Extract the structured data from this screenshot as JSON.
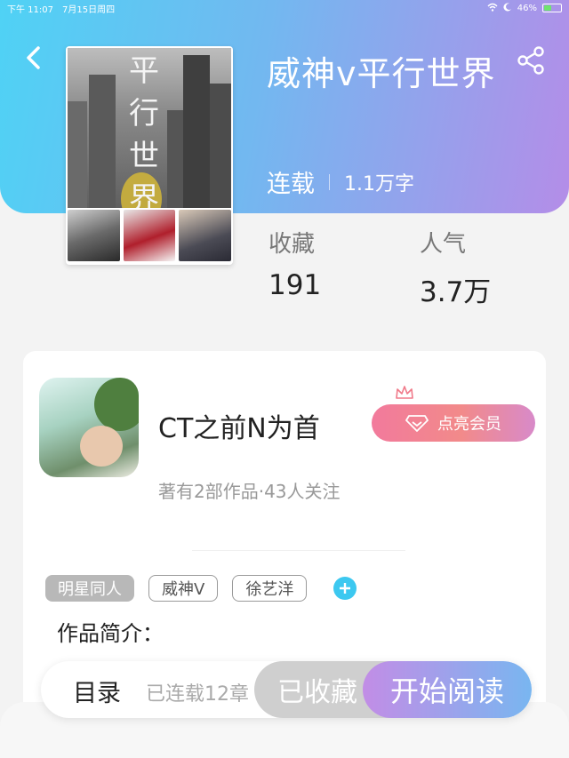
{
  "status_bar": {
    "time": "下午 11:07",
    "date": "7月15日周四",
    "battery_percent": "46%",
    "battery_level": 0.46
  },
  "header": {
    "back_icon": "chevron-left-icon",
    "share_icon": "share-icon"
  },
  "book": {
    "cover_title_lines": [
      "平",
      "行",
      "世",
      "界"
    ],
    "title": "威神v平行世界",
    "status": "连载",
    "word_count": "1.1万字",
    "stats": {
      "favorites_label": "收藏",
      "favorites_value": "191",
      "popularity_label": "人气",
      "popularity_value": "3.7万"
    }
  },
  "author": {
    "name": "CT之前N为首",
    "vip_label": "点亮会员",
    "stats": "著有2部作品·43人关注"
  },
  "tags": [
    "明星同人",
    "威神V",
    "徐艺洋"
  ],
  "intro_label": "作品简介：",
  "bottom_bar": {
    "toc_label": "目录",
    "toc_progress": "已连载12章",
    "collected_label": "已收藏",
    "read_label": "开始阅读"
  },
  "colors": {
    "header_gradient_start": "#4fd2f5",
    "header_gradient_end": "#b48de8",
    "accent_blue": "#3cc8f0",
    "vip_pink": "#f27a9c"
  }
}
